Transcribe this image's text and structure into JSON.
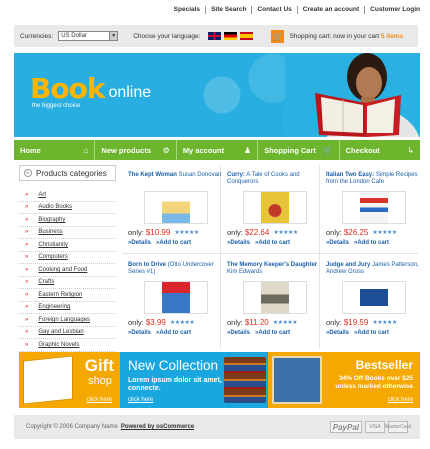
{
  "top_links": [
    "Specials",
    "Site Search",
    "Contact Us",
    "Create an account",
    "Customer Login"
  ],
  "bar": {
    "currencies_label": "Currencies:",
    "currency_value": "US Dollar",
    "language_label": "Choose your language:",
    "cart_label": "Shopping cart: now in your cart",
    "cart_count": "5 items",
    "accent": "#f08a1c"
  },
  "banner": {
    "logo_book": "Book",
    "logo_online": "online",
    "tagline": "the biggest choice"
  },
  "nav": [
    {
      "label": "Home",
      "icon": "home-icon",
      "glyph": "⌂"
    },
    {
      "label": "New products",
      "icon": "gear-icon",
      "glyph": "⚙"
    },
    {
      "label": "My account",
      "icon": "user-icon",
      "glyph": "♟"
    },
    {
      "label": "Shopping Cart",
      "icon": "cart-icon",
      "glyph": "🛒"
    },
    {
      "label": "Checkout",
      "icon": "arrow-icon",
      "glyph": "↳"
    }
  ],
  "sidebar": {
    "title": "Products categories",
    "categories": [
      "Art",
      "Audio Books",
      "Biography",
      "Business",
      "Christianity",
      "Computers",
      "Cooking and Food",
      "Crafts",
      "Eastern Religion",
      "Engineering",
      "Foreign Languages",
      "Gay and Lesbian",
      "Graphic Novels"
    ]
  },
  "products": [
    {
      "title": "The Kept Woman",
      "author": "Susan Donovan",
      "price": "$10.99",
      "cover": "#f2d57a"
    },
    {
      "title": "Curry:",
      "author": "A Tale of Cooks and Conquerors",
      "price": "$22.64",
      "cover": "#e7c43a"
    },
    {
      "title": "Italian Two Easy:",
      "author": "Simple Recipes from the London Cafe",
      "price": "$26.25",
      "cover": "#f4f4f4"
    },
    {
      "title": "Born to Drive",
      "author": "(Otto Undercover Series #1)",
      "price": "$3.99",
      "cover": "#3a78c5"
    },
    {
      "title": "The Memory Keeper's Daughter",
      "author": "Kim Edwards",
      "price": "$11.20",
      "cover": "#ddd8c8"
    },
    {
      "title": "Judge and Jury",
      "author": "James Patterson, Andrew Gross",
      "price": "$19.59",
      "cover": "#1d4e95"
    }
  ],
  "product_labels": {
    "only": "only:",
    "stars": "★★★★★",
    "details": "»Details",
    "add_to_cart": "»Add to cart"
  },
  "promos": {
    "gift_title": "Gift",
    "gift_sub": "shop",
    "gift_link": "click here",
    "new_title": "New Collection",
    "new_desc": "Lorem ipsum dolor sit amet, connecte.",
    "new_link": "click here",
    "best_title": "Bestseller",
    "best_desc_1": "34% Off Books over $25",
    "best_desc_2": "unless marked otherwise",
    "best_link": "click here"
  },
  "footer": {
    "copyright": "Copyright © 2006 Company Name",
    "powered": "Powered by osCommerce",
    "paypal": "PayPal",
    "card_1": "VISA",
    "card_2": "MasterCard"
  }
}
